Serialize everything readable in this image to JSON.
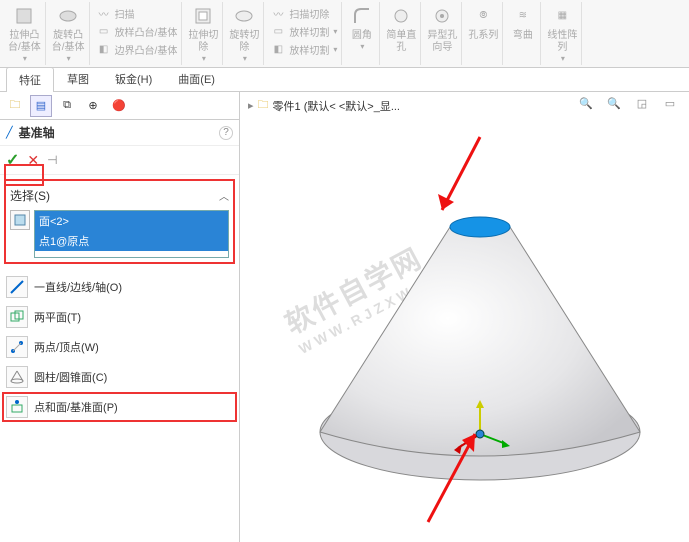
{
  "ribbon": {
    "extrude_boss": "拉伸凸\n台/基体",
    "revolve_boss": "旋转凸\n台/基体",
    "swept_boss": "扫描",
    "loft_boss": "放样凸台/基体",
    "boundary_boss": "边界凸台/基体",
    "extrude_cut": "拉伸切\n除",
    "revolve_cut": "旋转切\n除",
    "swept_cut": "扫描切除",
    "loft_cut": "放样切割",
    "boundary_cut": "放样切割",
    "fillet": "圆角",
    "simple_hole": "简单直\n孔",
    "hole_wizard": "异型孔\n向导",
    "hole_series": "孔系列",
    "wrap": "弯曲",
    "linear_pattern": "线性阵\n列"
  },
  "tabs": {
    "t1": "特征",
    "t2": "草图",
    "t3": "钣金(H)",
    "t4": "曲面(E)"
  },
  "feature": {
    "title": "基准轴",
    "help_aria": "help"
  },
  "selection": {
    "header": "选择(S)",
    "item1": "面<2>",
    "item2": "点1@原点"
  },
  "methods": {
    "m1": "一直线/边线/轴(O)",
    "m2": "两平面(T)",
    "m3": "两点/顶点(W)",
    "m4": "圆柱/圆锥面(C)",
    "m5": "点和面/基准面(P)"
  },
  "crumb": {
    "part": "零件1  (默认< <默认>_显..."
  },
  "confirm": {
    "ok": "✓",
    "cancel": "✕",
    "pin": "⊣"
  },
  "caret": "︿",
  "watermark": {
    "line1": "软件自学网",
    "line2": "WWW.RJZXW.COM"
  }
}
